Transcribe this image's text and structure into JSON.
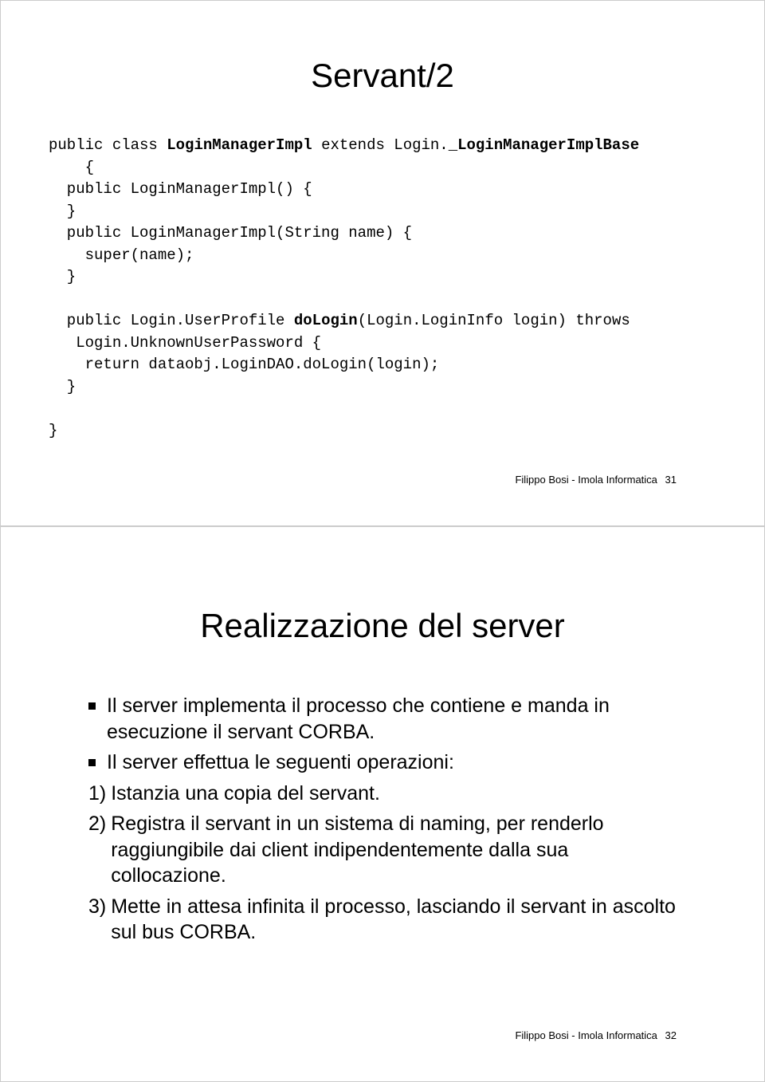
{
  "slide1": {
    "title": "Servant/2",
    "code": {
      "l1a": "public class ",
      "l1b": "LoginManagerImpl",
      "l1c": " extends Login.",
      "l1d": "_LoginManagerImplBase",
      "l2": "    {",
      "l3": "  public LoginManagerImpl() {",
      "l4": "  }",
      "l5": "  public LoginManagerImpl(String name) {",
      "l6": "    super(name);",
      "l7": "  }",
      "l8": "",
      "l9a": "  public Login.UserProfile ",
      "l9b": "doLogin",
      "l9c": "(Login.LoginInfo login) throws",
      "l10": "   Login.UnknownUserPassword {",
      "l11": "    return dataobj.LoginDAO.doLogin(login);",
      "l12": "  }",
      "l13": "",
      "l14": "}"
    },
    "footer_text": "Filippo Bosi - Imola Informatica",
    "footer_num": "31"
  },
  "slide2": {
    "title": "Realizzazione del server",
    "bullets": [
      "Il server implementa il processo che contiene e manda in esecuzione il servant CORBA.",
      "Il server effettua le seguenti operazioni:"
    ],
    "numbered": [
      {
        "n": "1)",
        "t": "Istanzia una copia del servant."
      },
      {
        "n": "2)",
        "t": "Registra il servant in un sistema di naming, per renderlo raggiungibile dai client indipendentemente dalla sua collocazione."
      },
      {
        "n": "3)",
        "t": "Mette in attesa infinita il processo, lasciando il servant in ascolto sul bus CORBA."
      }
    ],
    "footer_text": "Filippo Bosi - Imola Informatica",
    "footer_num": "32"
  }
}
